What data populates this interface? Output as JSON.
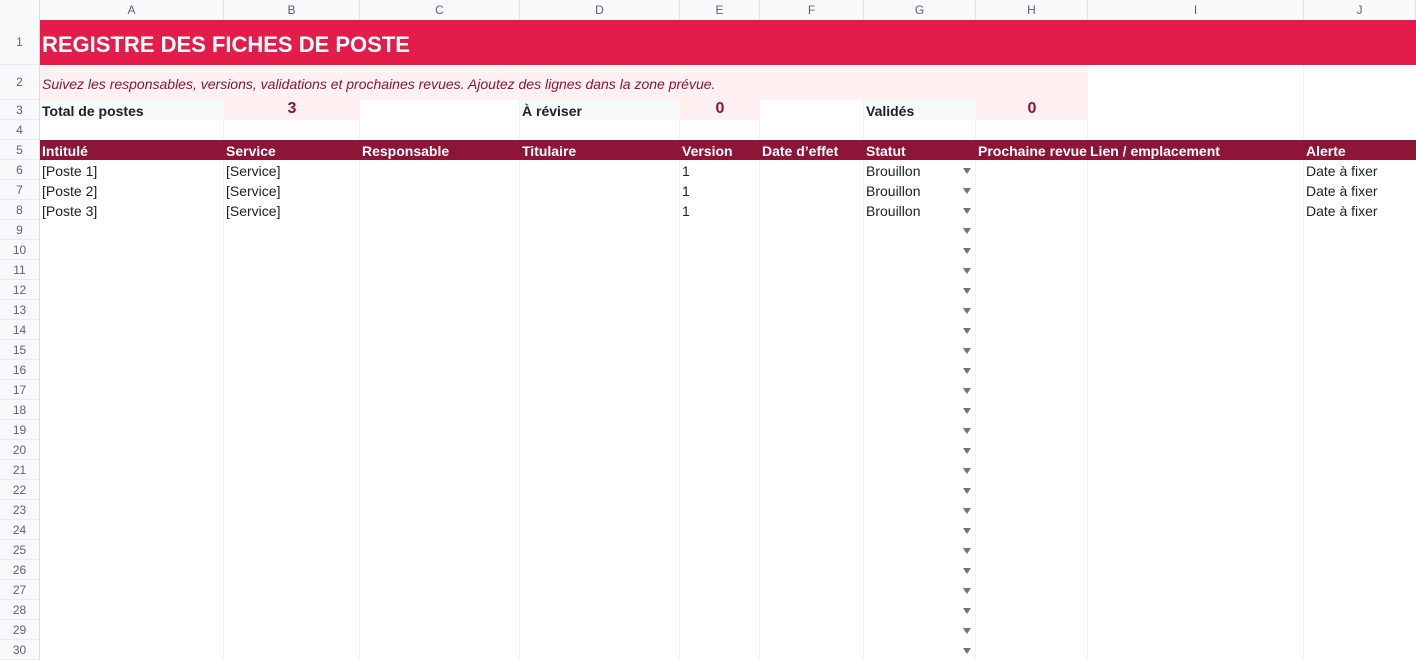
{
  "columns": [
    "A",
    "B",
    "C",
    "D",
    "E",
    "F",
    "G",
    "H",
    "I",
    "J"
  ],
  "rows": [
    "1",
    "2",
    "3",
    "4",
    "5",
    "6",
    "7",
    "8",
    "9",
    "10",
    "11",
    "12",
    "13",
    "14",
    "15",
    "16",
    "17",
    "18",
    "19",
    "20",
    "21",
    "22",
    "23",
    "24",
    "25",
    "26",
    "27",
    "28",
    "29",
    "30"
  ],
  "title": "REGISTRE DES FICHES DE POSTE",
  "subtitle": "Suivez les responsables, versions, validations et prochaines revues. Ajoutez des lignes dans la zone prévue.",
  "summary": {
    "total_label": "Total de postes",
    "total_value": "3",
    "review_label": "À réviser",
    "review_value": "0",
    "validated_label": "Validés",
    "validated_value": "0"
  },
  "table": {
    "headers": [
      "Intitulé",
      "Service",
      "Responsable",
      "Titulaire",
      "Version",
      "Date d’effet",
      "Statut",
      "Prochaine revue",
      "Lien / emplacement",
      "Alerte"
    ],
    "rows": [
      [
        "[Poste 1]",
        "[Service]",
        "",
        "",
        "1",
        "",
        "Brouillon",
        "",
        "",
        "Date à fixer"
      ],
      [
        "[Poste 2]",
        "[Service]",
        "",
        "",
        "1",
        "",
        "Brouillon",
        "",
        "",
        "Date à fixer"
      ],
      [
        "[Poste 3]",
        "[Service]",
        "",
        "",
        "1",
        "",
        "Brouillon",
        "",
        "",
        "Date à fixer"
      ]
    ]
  },
  "dropdown_icon": "triangle-down-icon",
  "colors": {
    "title_band": "#e31c4a",
    "header_band": "#8c1538",
    "kpi_fill": "#fff1f1",
    "kpi_text": "#8c1538"
  }
}
